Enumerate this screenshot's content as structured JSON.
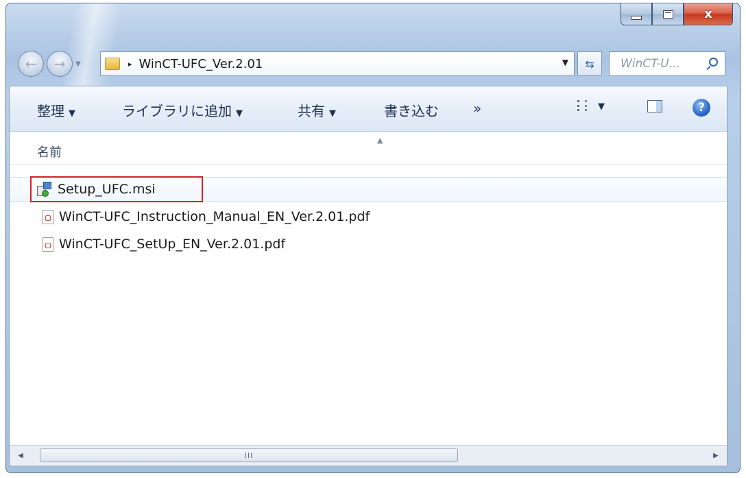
{
  "window": {
    "caption": {
      "minimize_icon": "minimize-icon",
      "maximize_icon": "maximize-icon",
      "close_glyph": "x"
    }
  },
  "nav": {
    "back_icon": "back-arrow-icon",
    "forward_icon": "forward-arrow-icon",
    "breadcrumb_separator": "▸",
    "breadcrumb": [
      "WinCT-UFC_Ver.2.01"
    ],
    "search_placeholder": "WinCT-U..."
  },
  "toolbar": {
    "organize": "整理",
    "add_to_library": "ライブラリに追加",
    "share": "共有",
    "burn": "書き込む",
    "more": "»"
  },
  "columns": {
    "name": "名前"
  },
  "files": [
    {
      "name": "Setup_UFC.msi",
      "type": "msi",
      "selected": true
    },
    {
      "name": "WinCT-UFC_Instruction_Manual_EN_Ver.2.01.pdf",
      "type": "pdf",
      "selected": false
    },
    {
      "name": "WinCT-UFC_SetUp_EN_Ver.2.01.pdf",
      "type": "pdf",
      "selected": false
    }
  ],
  "scrollbar": {
    "thumb_grip": "III"
  },
  "colors": {
    "frame": "#a9c3e2",
    "close_button": "#c7371f",
    "highlight": "#d61f2a",
    "toolbar_text": "#1e3050"
  }
}
